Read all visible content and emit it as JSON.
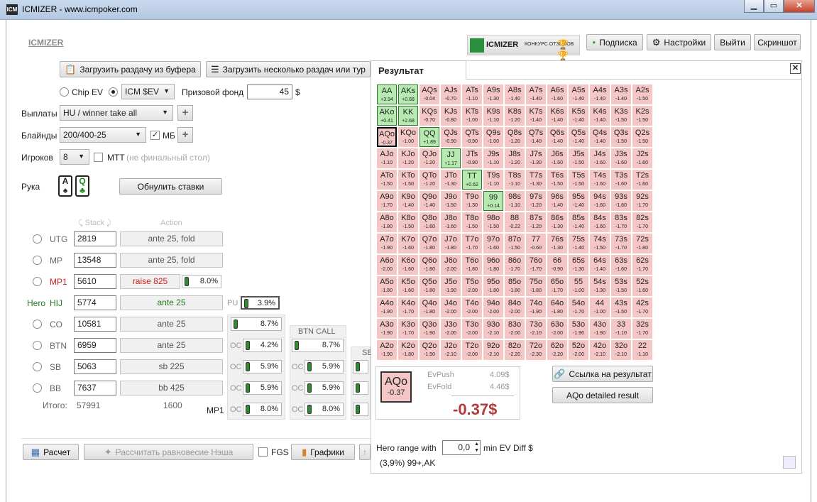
{
  "window": {
    "title": "ICMIZER - www.icmpoker.com",
    "icon_text": "ICM"
  },
  "header": {
    "logo": "ICMIZER",
    "banner_brand": "ICMIZER",
    "banner_text": "КОНКУРС ОТЗЫВОВ",
    "subscription": "Подписка",
    "settings": "Настройки",
    "logout": "Выйти",
    "screenshot": "Скриншот"
  },
  "toolbar": {
    "load_hand": "Загрузить раздачу из буфера",
    "load_many": "Загрузить несколько раздач или тур"
  },
  "model": {
    "chip_ev": "Chip EV",
    "icm_select": "ICM $EV",
    "prize_label": "Призовой фонд",
    "prize_value": "45",
    "currency": "$"
  },
  "payouts": {
    "label": "Выплаты",
    "value": "HU / winner take all"
  },
  "blinds": {
    "label": "Блайнды",
    "value": "200/400-25",
    "mb": "МБ"
  },
  "players": {
    "label": "Игроков",
    "value": "8",
    "mtt": "МТТ",
    "mtt_note": "(не финальный стол)"
  },
  "hand": {
    "label": "Рука",
    "card1_rank": "A",
    "card1_suit": "♠",
    "card2_rank": "Q",
    "card2_suit": "♣",
    "reset": "Обнулить ставки"
  },
  "table": {
    "stack_header": "Stack",
    "action_header": "Action",
    "total_label": "Итого:",
    "total_stack": "57991",
    "total_action": "1600",
    "rows": [
      {
        "pos": "UTG",
        "stack": "2819",
        "action": "ante 25, fold"
      },
      {
        "pos": "MP",
        "stack": "13548",
        "action": "ante 25, fold"
      },
      {
        "pos": "MP1",
        "stack": "5610",
        "action": "raise 825",
        "pct": "8.0%"
      },
      {
        "pos": "HIJ",
        "hero": "Hero",
        "stack": "5774",
        "action": "ante 25",
        "pu": "PU",
        "pct": "3.9%"
      },
      {
        "pos": "CO",
        "stack": "10581",
        "action": "ante 25",
        "pct": "8.7%"
      },
      {
        "pos": "BTN",
        "stack": "6959",
        "action": "ante 25",
        "oc": "OC",
        "pct": "4.2%",
        "pct2": "8.7%"
      },
      {
        "pos": "SB",
        "stack": "5063",
        "action": "sb 225",
        "oc": "OC",
        "pct": "5.9%",
        "pct2": "5.9%"
      },
      {
        "pos": "BB",
        "stack": "7637",
        "action": "bb 425",
        "oc": "OC",
        "pct": "5.9%",
        "pct2": "5.9%"
      }
    ],
    "footer_pos": "MP1",
    "footer_pct": "8.0%",
    "footer_pct2": "8.0%",
    "col2_header": "BTN CALL",
    "col3_header": "SB"
  },
  "bottom": {
    "calc": "Расчет",
    "nash": "Рассчитать равновесие Нэша",
    "fgs": "FGS",
    "charts": "Графики"
  },
  "result": {
    "tab": "Результат",
    "hand": "AQo",
    "hand_ev": "-0.37",
    "ev_push_label": "EvPush",
    "ev_push": "4.09$",
    "ev_fold_label": "EvFold",
    "ev_fold": "4.46$",
    "ev_diff": "-0.37$",
    "link_button": "Ссылка на результат",
    "detail_button": "AQo detailed result",
    "hero_range_label": "Hero range with",
    "hero_range_value": "0,0",
    "hero_range_suffix": "min EV Diff $",
    "range_text": "(3,9%) 99+,AK"
  },
  "grid": [
    [
      [
        "AA",
        "+3.94"
      ],
      [
        "AKs",
        "+0.68"
      ],
      [
        "AQs",
        "-0.04"
      ],
      [
        "AJs",
        "-0.70"
      ],
      [
        "ATs",
        "-1.10"
      ],
      [
        "A9s",
        "-1.30"
      ],
      [
        "A8s",
        "-1.40"
      ],
      [
        "A7s",
        "-1.40"
      ],
      [
        "A6s",
        "-1.60"
      ],
      [
        "A5s",
        "-1.40"
      ],
      [
        "A4s",
        "-1.40"
      ],
      [
        "A3s",
        "-1.40"
      ],
      [
        "A2s",
        "-1.50"
      ]
    ],
    [
      [
        "AKo",
        "+0.41"
      ],
      [
        "KK",
        "+2.68"
      ],
      [
        "KQs",
        "-0.70"
      ],
      [
        "KJs",
        "-0.80"
      ],
      [
        "KTs",
        "-1.00"
      ],
      [
        "K9s",
        "-1.10"
      ],
      [
        "K8s",
        "-1.20"
      ],
      [
        "K7s",
        "-1.40"
      ],
      [
        "K6s",
        "-1.40"
      ],
      [
        "K5s",
        "-1.40"
      ],
      [
        "K4s",
        "-1.40"
      ],
      [
        "K3s",
        "-1.50"
      ],
      [
        "K2s",
        "-1.50"
      ]
    ],
    [
      [
        "AQo",
        "-0.37"
      ],
      [
        "KQo",
        "-1.00"
      ],
      [
        "QQ",
        "+1.89"
      ],
      [
        "QJs",
        "-0.90"
      ],
      [
        "QTs",
        "-0.90"
      ],
      [
        "Q9s",
        "-1.00"
      ],
      [
        "Q8s",
        "-1.20"
      ],
      [
        "Q7s",
        "-1.40"
      ],
      [
        "Q6s",
        "-1.40"
      ],
      [
        "Q5s",
        "-1.40"
      ],
      [
        "Q4s",
        "-1.40"
      ],
      [
        "Q3s",
        "-1.50"
      ],
      [
        "Q2s",
        "-1.50"
      ]
    ],
    [
      [
        "AJo",
        "-1.10"
      ],
      [
        "KJo",
        "-1.20"
      ],
      [
        "QJo",
        "-1.20"
      ],
      [
        "JJ",
        "+1.17"
      ],
      [
        "JTs",
        "-0.90"
      ],
      [
        "J9s",
        "-1.10"
      ],
      [
        "J8s",
        "-1.20"
      ],
      [
        "J7s",
        "-1.30"
      ],
      [
        "J6s",
        "-1.50"
      ],
      [
        "J5s",
        "-1.50"
      ],
      [
        "J4s",
        "-1.60"
      ],
      [
        "J3s",
        "-1.60"
      ],
      [
        "J2s",
        "-1.60"
      ]
    ],
    [
      [
        "ATo",
        "-1.50"
      ],
      [
        "KTo",
        "-1.50"
      ],
      [
        "QTo",
        "-1.20"
      ],
      [
        "JTo",
        "-1.30"
      ],
      [
        "TT",
        "+0.62"
      ],
      [
        "T9s",
        "-1.10"
      ],
      [
        "T8s",
        "-1.10"
      ],
      [
        "T7s",
        "-1.30"
      ],
      [
        "T6s",
        "-1.50"
      ],
      [
        "T5s",
        "-1.50"
      ],
      [
        "T4s",
        "-1.60"
      ],
      [
        "T3s",
        "-1.60"
      ],
      [
        "T2s",
        "-1.60"
      ]
    ],
    [
      [
        "A9o",
        "-1.70"
      ],
      [
        "K9o",
        "-1.40"
      ],
      [
        "Q9o",
        "-1.40"
      ],
      [
        "J9o",
        "-1.50"
      ],
      [
        "T9o",
        "-1.30"
      ],
      [
        "99",
        "+0.14"
      ],
      [
        "98s",
        "-1.10"
      ],
      [
        "97s",
        "-1.20"
      ],
      [
        "96s",
        "-1.40"
      ],
      [
        "95s",
        "-1.40"
      ],
      [
        "94s",
        "-1.60"
      ],
      [
        "93s",
        "-1.60"
      ],
      [
        "92s",
        "-1.70"
      ]
    ],
    [
      [
        "A8o",
        "-1.80"
      ],
      [
        "K8o",
        "-1.50"
      ],
      [
        "Q8o",
        "-1.60"
      ],
      [
        "J8o",
        "-1.60"
      ],
      [
        "T8o",
        "-1.50"
      ],
      [
        "98o",
        "-1.50"
      ],
      [
        "88",
        "-0.22"
      ],
      [
        "87s",
        "-1.20"
      ],
      [
        "86s",
        "-1.30"
      ],
      [
        "85s",
        "-1.40"
      ],
      [
        "84s",
        "-1.60"
      ],
      [
        "83s",
        "-1.70"
      ],
      [
        "82s",
        "-1.70"
      ]
    ],
    [
      [
        "A7o",
        "-1.90"
      ],
      [
        "K7o",
        "-1.60"
      ],
      [
        "Q7o",
        "-1.80"
      ],
      [
        "J7o",
        "-1.80"
      ],
      [
        "T7o",
        "-1.70"
      ],
      [
        "97o",
        "-1.60"
      ],
      [
        "87o",
        "-1.50"
      ],
      [
        "77",
        "-0.60"
      ],
      [
        "76s",
        "-1.30"
      ],
      [
        "75s",
        "-1.40"
      ],
      [
        "74s",
        "-1.50"
      ],
      [
        "73s",
        "-1.70"
      ],
      [
        "72s",
        "-1.80"
      ]
    ],
    [
      [
        "A6o",
        "-2.00"
      ],
      [
        "K6o",
        "-1.60"
      ],
      [
        "Q6o",
        "-1.80"
      ],
      [
        "J6o",
        "-2.00"
      ],
      [
        "T6o",
        "-1.80"
      ],
      [
        "96o",
        "-1.80"
      ],
      [
        "86o",
        "-1.70"
      ],
      [
        "76o",
        "-1.70"
      ],
      [
        "66",
        "-0.90"
      ],
      [
        "65s",
        "-1.30"
      ],
      [
        "64s",
        "-1.40"
      ],
      [
        "63s",
        "-1.60"
      ],
      [
        "62s",
        "-1.70"
      ]
    ],
    [
      [
        "A5o",
        "-1.80"
      ],
      [
        "K5o",
        "-1.60"
      ],
      [
        "Q5o",
        "-1.80"
      ],
      [
        "J5o",
        "-1.90"
      ],
      [
        "T5o",
        "-2.00"
      ],
      [
        "95o",
        "-1.80"
      ],
      [
        "85o",
        "-1.80"
      ],
      [
        "75o",
        "-1.80"
      ],
      [
        "65o",
        "-1.70"
      ],
      [
        "55",
        "-1.00"
      ],
      [
        "54s",
        "-1.30"
      ],
      [
        "53s",
        "-1.50"
      ],
      [
        "52s",
        "-1.60"
      ]
    ],
    [
      [
        "A4o",
        "-1.90"
      ],
      [
        "K4o",
        "-1.70"
      ],
      [
        "Q4o",
        "-1.80"
      ],
      [
        "J4o",
        "-2.00"
      ],
      [
        "T4o",
        "-2.00"
      ],
      [
        "94o",
        "-2.00"
      ],
      [
        "84o",
        "-2.00"
      ],
      [
        "74o",
        "-1.90"
      ],
      [
        "64o",
        "-1.80"
      ],
      [
        "54o",
        "-1.70"
      ],
      [
        "44",
        "-1.00"
      ],
      [
        "43s",
        "-1.50"
      ],
      [
        "42s",
        "-1.70"
      ]
    ],
    [
      [
        "A3o",
        "-1.90"
      ],
      [
        "K3o",
        "-1.70"
      ],
      [
        "Q3o",
        "-1.90"
      ],
      [
        "J3o",
        "-2.00"
      ],
      [
        "T3o",
        "-2.00"
      ],
      [
        "93o",
        "-2.10"
      ],
      [
        "83o",
        "-2.00"
      ],
      [
        "73o",
        "-2.10"
      ],
      [
        "63o",
        "-2.00"
      ],
      [
        "53o",
        "-1.90"
      ],
      [
        "43o",
        "-1.90"
      ],
      [
        "33",
        "-1.10"
      ],
      [
        "32s",
        "-1.70"
      ]
    ],
    [
      [
        "A2o",
        "-1.90"
      ],
      [
        "K2o",
        "-1.80"
      ],
      [
        "Q2o",
        "-1.90"
      ],
      [
        "J2o",
        "-2.10"
      ],
      [
        "T2o",
        "-2.00"
      ],
      [
        "92o",
        "-2.10"
      ],
      [
        "82o",
        "-2.20"
      ],
      [
        "72o",
        "-2.30"
      ],
      [
        "62o",
        "-2.20"
      ],
      [
        "52o",
        "-2.00"
      ],
      [
        "42o",
        "-2.10"
      ],
      [
        "32o",
        "-2.10"
      ],
      [
        "22",
        "-1.10"
      ]
    ]
  ]
}
